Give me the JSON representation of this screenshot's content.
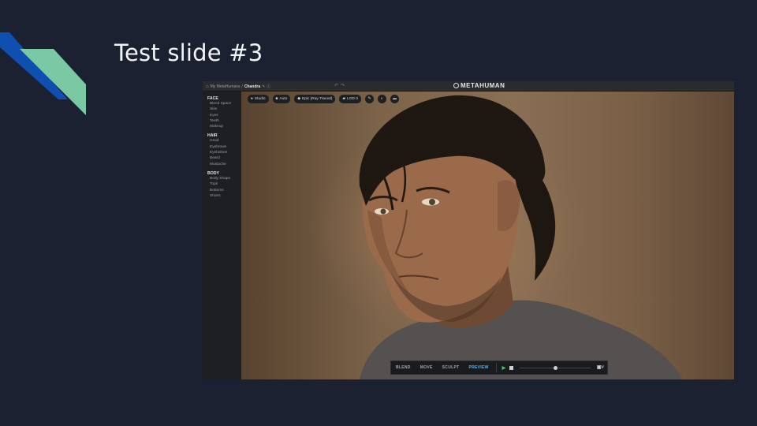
{
  "slide": {
    "title": "Test slide #3"
  },
  "app": {
    "breadcrumb": {
      "root": "My MetaHumans",
      "separator": "/",
      "current": "Chandra"
    },
    "brand": "METAHUMAN",
    "sidebar": [
      {
        "heading": "FACE",
        "items": [
          "Blend Space",
          "Skin",
          "Eyes",
          "Teeth",
          "Makeup"
        ]
      },
      {
        "heading": "HAIR",
        "items": [
          "Head",
          "Eyebrows",
          "Eyelashes",
          "Beard",
          "Mustache"
        ]
      },
      {
        "heading": "BODY",
        "items": [
          "Body Shape",
          "Tops",
          "Bottoms",
          "Shoes"
        ]
      }
    ],
    "viewport_pills": [
      {
        "icon": "lightbulb-icon",
        "label": "Studio"
      },
      {
        "icon": "camera-icon",
        "label": "Auto"
      },
      {
        "icon": "quality-icon",
        "label": "Epic (Ray Traced)"
      },
      {
        "icon": "lod-icon",
        "label": "LOD 0"
      }
    ],
    "toolbar": {
      "modes": [
        "BLEND",
        "MOVE",
        "SCULPT",
        "PREVIEW"
      ],
      "active_mode": "PREVIEW"
    },
    "colors": {
      "active_mode": "#4fb8ff",
      "play": "#39d15a",
      "accent_dark": "#0f4fb0",
      "accent_light": "#7ac8a4"
    }
  }
}
